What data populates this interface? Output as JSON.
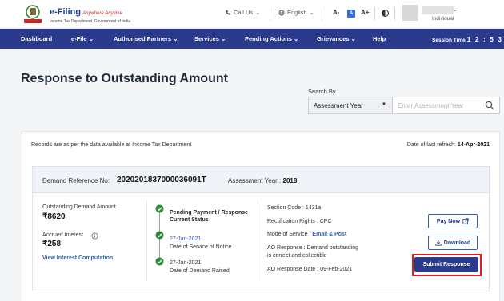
{
  "header": {
    "brand_title": "e-Filing",
    "brand_tagline": "Anywhere Anytime",
    "brand_subtitle": "Income Tax Department, Government of India",
    "call_us": "Call Us",
    "language": "English",
    "font_decrease": "A-",
    "font_reset": "A",
    "font_increase": "A+",
    "user_role": "Individual"
  },
  "nav": {
    "items": [
      "Dashboard",
      "e-File",
      "Authorised Partners",
      "Services",
      "Pending Actions",
      "Grievances",
      "Help"
    ],
    "session_label": "Session Time",
    "session_time": "1 2 : 5 3"
  },
  "page": {
    "title": "Response to Outstanding Amount",
    "search_by_label": "Search By",
    "search_by_value": "Assessment Year",
    "search_placeholder": "Enter Assessment Year",
    "records_note": "Records are as per the data available at Income Tax Department",
    "refresh_label": "Date of last refresh:",
    "refresh_date": "14-Apr-2021"
  },
  "demand": {
    "ref_label": "Demand Reference No:",
    "ref_value": "2020201837000036091T",
    "ay_label": "Assessment Year :",
    "ay_value": "2018",
    "outstanding_label": "Outstanding Demand Amount",
    "outstanding_value": "₹8620",
    "interest_label": "Accrued Interest",
    "interest_value": "₹258",
    "interest_link": "View Interest Computation",
    "status_line1": "Pending Payment / Response",
    "status_line2": "Current Status",
    "notice_date": "27-Jan-2021",
    "notice_label": "Date of Service of Notice",
    "raised_date": "27-Jan-2021",
    "raised_label": "Date of Demand Raised",
    "section_code": "Section Code : 1431a",
    "rectification": "Rectification Rights : CPC",
    "mode_label": "Mode of Service :",
    "mode_value": "Email & Post",
    "ao_response_line1": "AO Response : Demand outstanding",
    "ao_response_line2": "is correct and collectible",
    "ao_response_date": "AO Response Date : 09-Feb-2021",
    "pay_now": "Pay Now",
    "download": "Download",
    "submit_response": "Submit Response"
  },
  "colors": {
    "nav_bg": "#2a3a8c",
    "link": "#2f5fb3",
    "success": "#2e8b3e",
    "highlight": "#e01e1e"
  }
}
